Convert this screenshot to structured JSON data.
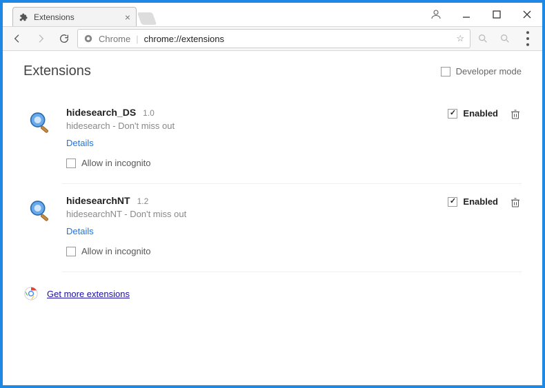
{
  "tab": {
    "title": "Extensions"
  },
  "omnibox": {
    "host": "Chrome",
    "path": "chrome://extensions"
  },
  "page": {
    "title": "Extensions",
    "developer_mode_label": "Developer mode"
  },
  "extensions": [
    {
      "name": "hidesearch_DS",
      "version": "1.0",
      "description": "hidesearch - Don't miss out",
      "details_label": "Details",
      "incognito_label": "Allow in incognito",
      "enabled_label": "Enabled"
    },
    {
      "name": "hidesearchNT",
      "version": "1.2",
      "description": "hidesearchNT - Don't miss out",
      "details_label": "Details",
      "incognito_label": "Allow in incognito",
      "enabled_label": "Enabled"
    }
  ],
  "getmore": {
    "label": "Get more extensions"
  }
}
